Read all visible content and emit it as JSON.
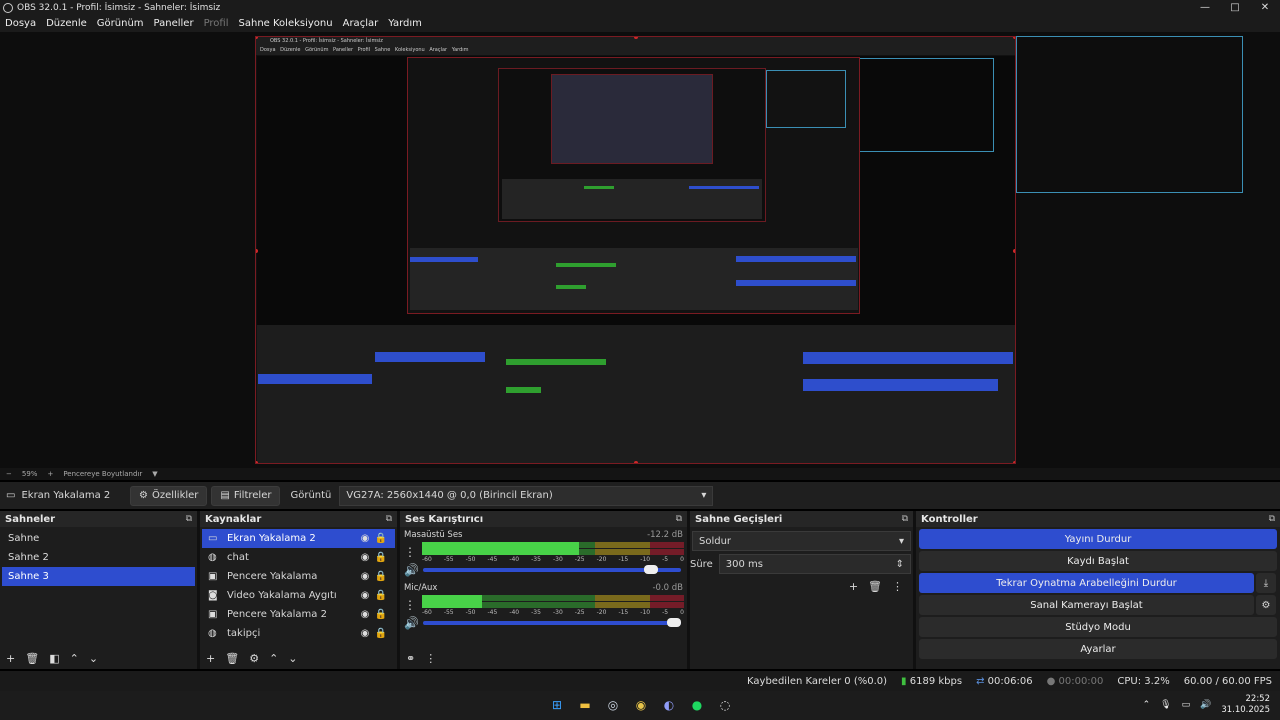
{
  "window": {
    "title": "OBS 32.0.1 - Profil: İsimsiz - Sahneler: İsimsiz",
    "min": "—",
    "max": "□",
    "close": "✕"
  },
  "menu": {
    "dosya": "Dosya",
    "duzenle": "Düzenle",
    "gorunum": "Görünüm",
    "paneller": "Paneller",
    "profil": "Profil",
    "sahne_koleksiyonu": "Sahne Koleksiyonu",
    "araclar": "Araçlar",
    "yardim": "Yardım"
  },
  "nested": {
    "title": "OBS 32.0.1 - Profil: İsimsiz - Sahneler: İsimsiz",
    "menu": "Dosya Düzenle Görünüm Paneller Profil Sahne Koleksiyonu Araçlar Yardım"
  },
  "preview_bar": {
    "minus": "−",
    "zoom": "59%",
    "plus": "+",
    "fit": "Pencereye Boyutlandır",
    "arrow": "▼"
  },
  "source_bar": {
    "source_name": "Ekran Yakalama 2",
    "properties": "Özellikler",
    "filters": "Filtreler",
    "display_label": "Görüntü",
    "display_value": "VG27A: 2560x1440 @ 0,0 (Birincil Ekran)"
  },
  "scenes": {
    "title": "Sahneler",
    "items": [
      "Sahne",
      "Sahne 2",
      "Sahne 3"
    ],
    "selected": 2
  },
  "sources": {
    "title": "Kaynaklar",
    "items": [
      {
        "name": "Ekran Yakalama 2",
        "icon": "monitor-icon"
      },
      {
        "name": "chat",
        "icon": "globe-icon"
      },
      {
        "name": "Pencere Yakalama",
        "icon": "window-icon"
      },
      {
        "name": "Video Yakalama Aygıtı",
        "icon": "camera-icon"
      },
      {
        "name": "Pencere Yakalama 2",
        "icon": "window-icon"
      },
      {
        "name": "takipçi",
        "icon": "globe-icon"
      }
    ]
  },
  "mixer": {
    "title": "Ses Karıştırıcı",
    "channels": [
      {
        "name": "Masaüstü Ses",
        "db": "-12.2 dB",
        "level": 0.6,
        "volume": 0.91
      },
      {
        "name": "Mic/Aux",
        "db": "-0.0 dB",
        "level": 0.23,
        "volume": 1.0
      }
    ],
    "ticks": [
      "-60",
      "-55",
      "-50",
      "-45",
      "-40",
      "-35",
      "-30",
      "-25",
      "-20",
      "-15",
      "-10",
      "-5",
      "0"
    ]
  },
  "transitions": {
    "title": "Sahne Geçişleri",
    "type": "Soldur",
    "duration_label": "Süre",
    "duration_value": "300 ms"
  },
  "controls": {
    "title": "Kontroller",
    "stop_stream": "Yayını Durdur",
    "start_record": "Kaydı Başlat",
    "stop_replay": "Tekrar Oynatma Arabelleğini Durdur",
    "start_vcam": "Sanal Kamerayı Başlat",
    "studio_mode": "Stüdyo Modu",
    "settings": "Ayarlar"
  },
  "status": {
    "dropped": "Kaybedilen Kareler 0 (%0.0)",
    "bitrate": "6189 kbps",
    "stream_time": "00:06:06",
    "rec_time": "00:00:00",
    "cpu": "CPU: 3.2%",
    "fps": "60.00 / 60.00 FPS"
  },
  "taskbar": {
    "time": "22:52",
    "date": "31.10.2025"
  },
  "colors": {
    "accent": "#2e4dcf",
    "selection_border": "#7a1b22",
    "bg": "#1d1d1d"
  }
}
